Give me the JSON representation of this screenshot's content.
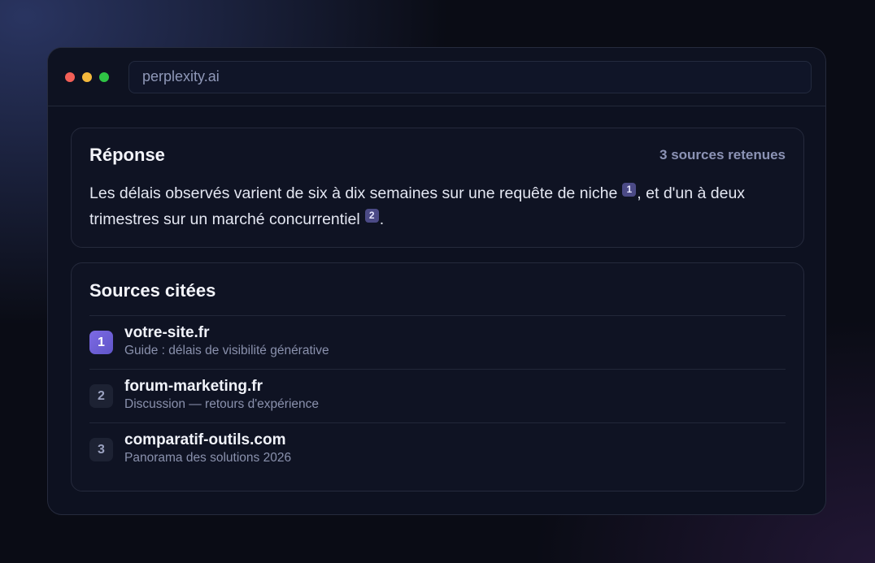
{
  "browser": {
    "url": "perplexity.ai",
    "traffic_lights": [
      "#f35f57",
      "#f4b83c",
      "#2fc445"
    ]
  },
  "answer": {
    "title": "Réponse",
    "sources_count": "3 sources retenues",
    "text_part1": "Les délais observés varient de six à dix semaines sur une requête de niche",
    "cite1": "1",
    "text_part2": ", et d'un à deux trimestres sur un marché concurrentiel",
    "cite2": "2",
    "text_part3": "."
  },
  "sources": {
    "title": "Sources citées",
    "items": [
      {
        "num": "1",
        "domain": "votre-site.fr",
        "desc": "Guide : délais de visibilité générative",
        "active": true
      },
      {
        "num": "2",
        "domain": "forum-marketing.fr",
        "desc": "Discussion — retours d'expérience",
        "active": false
      },
      {
        "num": "3",
        "domain": "comparatif-outils.com",
        "desc": "Panorama des solutions 2026",
        "active": false
      }
    ]
  },
  "colors": {
    "accent": "#6f5fd6",
    "citation_badge": "#4b4a86",
    "window_bg": "#0d1120"
  }
}
